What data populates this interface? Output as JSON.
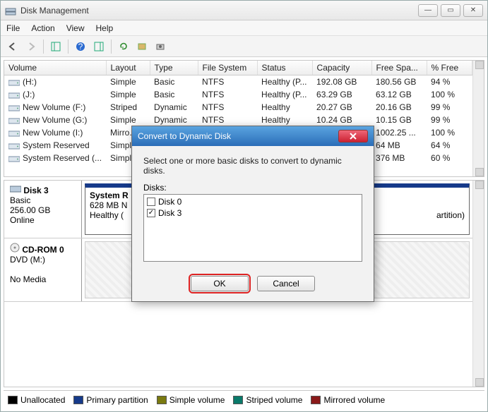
{
  "window": {
    "title": "Disk Management",
    "buttons": {
      "min": "—",
      "max": "▭",
      "close": "✕"
    }
  },
  "menu": {
    "file": "File",
    "action": "Action",
    "view": "View",
    "help": "Help"
  },
  "columns": {
    "volume": "Volume",
    "layout": "Layout",
    "type": "Type",
    "fs": "File System",
    "status": "Status",
    "capacity": "Capacity",
    "free": "Free Spa...",
    "pct": "% Free"
  },
  "rows": [
    {
      "vol": "(H:)",
      "layout": "Simple",
      "type": "Basic",
      "fs": "NTFS",
      "status": "Healthy (P...",
      "cap": "192.08 GB",
      "free": "180.56 GB",
      "pct": "94 %"
    },
    {
      "vol": "(J:)",
      "layout": "Simple",
      "type": "Basic",
      "fs": "NTFS",
      "status": "Healthy (P...",
      "cap": "63.29 GB",
      "free": "63.12 GB",
      "pct": "100 %"
    },
    {
      "vol": "New Volume (F:)",
      "layout": "Striped",
      "type": "Dynamic",
      "fs": "NTFS",
      "status": "Healthy",
      "cap": "20.27 GB",
      "free": "20.16 GB",
      "pct": "99 %"
    },
    {
      "vol": "New Volume (G:)",
      "layout": "Simple",
      "type": "Dynamic",
      "fs": "NTFS",
      "status": "Healthy",
      "cap": "10.24 GB",
      "free": "10.15 GB",
      "pct": "99 %"
    },
    {
      "vol": "New Volume (I:)",
      "layout": "Mirro...",
      "type": "",
      "fs": "",
      "status": "",
      "cap": "",
      "free": "1002.25 ...",
      "pct": "100 %"
    },
    {
      "vol": "System Reserved",
      "layout": "Simpl...",
      "type": "",
      "fs": "",
      "status": "",
      "cap": "",
      "free": "64 MB",
      "pct": "64 %"
    },
    {
      "vol": "System Reserved (...",
      "layout": "Simpl...",
      "type": "",
      "fs": "",
      "status": "",
      "cap": "",
      "free": "376 MB",
      "pct": "60 %"
    }
  ],
  "disk3": {
    "name": "Disk 3",
    "type": "Basic",
    "size": "256.00 GB",
    "state": "Online",
    "part1_name": "System R",
    "part1_size": "628 MB N",
    "part1_status": "Healthy (",
    "part2_status_suffix": "artition)"
  },
  "cdrom": {
    "name": "CD-ROM 0",
    "type": "DVD (M:)",
    "state": "No Media"
  },
  "legend": {
    "unalloc": "Unallocated",
    "primary": "Primary partition",
    "simple": "Simple volume",
    "striped": "Striped volume",
    "mirrored": "Mirrored volume"
  },
  "dialog": {
    "title": "Convert to Dynamic Disk",
    "instruction": "Select one or more basic disks to convert to dynamic disks.",
    "label": "Disks:",
    "items": [
      {
        "label": "Disk 0",
        "checked": false
      },
      {
        "label": "Disk 3",
        "checked": true
      }
    ],
    "ok": "OK",
    "cancel": "Cancel"
  }
}
